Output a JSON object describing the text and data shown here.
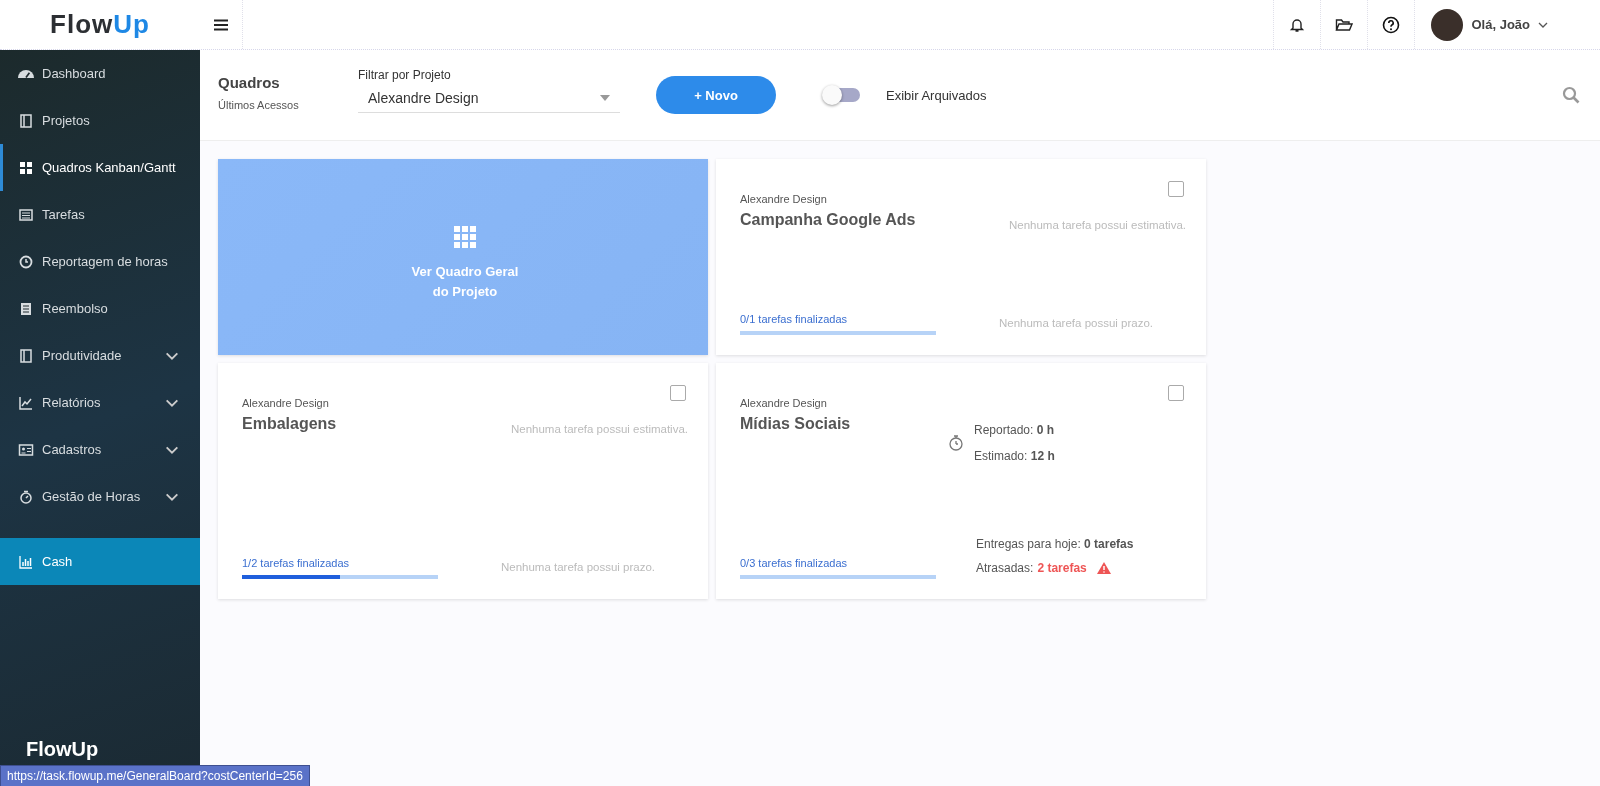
{
  "header": {
    "logo": {
      "dark": "Flow",
      "accent": "Up"
    },
    "user_greeting": "Olá, João"
  },
  "sidebar": {
    "items": [
      {
        "label": "Dashboard",
        "selected": false,
        "hovered": false,
        "expandable": false
      },
      {
        "label": "Projetos",
        "selected": false,
        "hovered": false,
        "expandable": false
      },
      {
        "label": "Quadros Kanban/Gantt",
        "selected": true,
        "hovered": false,
        "expandable": false
      },
      {
        "label": "Tarefas",
        "selected": false,
        "hovered": false,
        "expandable": false
      },
      {
        "label": "Reportagem de horas",
        "selected": false,
        "hovered": false,
        "expandable": false
      },
      {
        "label": "Reembolso",
        "selected": false,
        "hovered": false,
        "expandable": false
      },
      {
        "label": "Produtividade",
        "selected": false,
        "hovered": false,
        "expandable": true
      },
      {
        "label": "Relatórios",
        "selected": false,
        "hovered": false,
        "expandable": true
      },
      {
        "label": "Cadastros",
        "selected": false,
        "hovered": false,
        "expandable": true
      },
      {
        "label": "Gestão de Horas",
        "selected": false,
        "hovered": false,
        "expandable": true
      },
      {
        "label": "Cash",
        "selected": false,
        "hovered": true,
        "expandable": false
      }
    ],
    "footer_logo": "FlowUp"
  },
  "toolbar": {
    "title": "Quadros",
    "subtitle": "Últimos Acessos",
    "filter": {
      "label": "Filtrar por Projeto",
      "value": "Alexandre Design"
    },
    "new_button": "+ Novo",
    "archived_toggle": {
      "label": "Exibir Arquivados",
      "on": false
    }
  },
  "boards": [
    {
      "kind": "overview",
      "label_lines": [
        "Ver Quadro Geral",
        "do Projeto"
      ]
    },
    {
      "kind": "board",
      "project": "Alexandre Design",
      "name": "Campanha Google Ads",
      "checked": false,
      "progress_text": "0/1 tarefas finalizadas",
      "level": 0,
      "estimate_note": "Nenhuma tarefa possui estimativa.",
      "deadline_note": "Nenhuma tarefa possui prazo."
    },
    {
      "kind": "board",
      "project": "Alexandre Design",
      "name": "Embalagens",
      "checked": false,
      "progress_text": "1/2 tarefas finalizadas",
      "level": 0.5,
      "estimate_note": "Nenhuma tarefa possui estimativa.",
      "deadline_note": "Nenhuma tarefa possui prazo."
    },
    {
      "kind": "board",
      "project": "Alexandre Design",
      "name": "Mídias Sociais",
      "checked": false,
      "progress_text": "0/3 tarefas finalizadas",
      "level": 0,
      "hours": {
        "reported": "Reportado: **0 h**",
        "estimated": "Estimado: **12 h**"
      },
      "deliveries": {
        "today": "Entregas para hoje: **0 tarefas**",
        "late_label": "Atrasadas:",
        "late_value": "2 tarefas"
      }
    }
  ],
  "status_bar": {
    "url": "https://task.flowup.me/GeneralBoard?costCenterId=256"
  }
}
